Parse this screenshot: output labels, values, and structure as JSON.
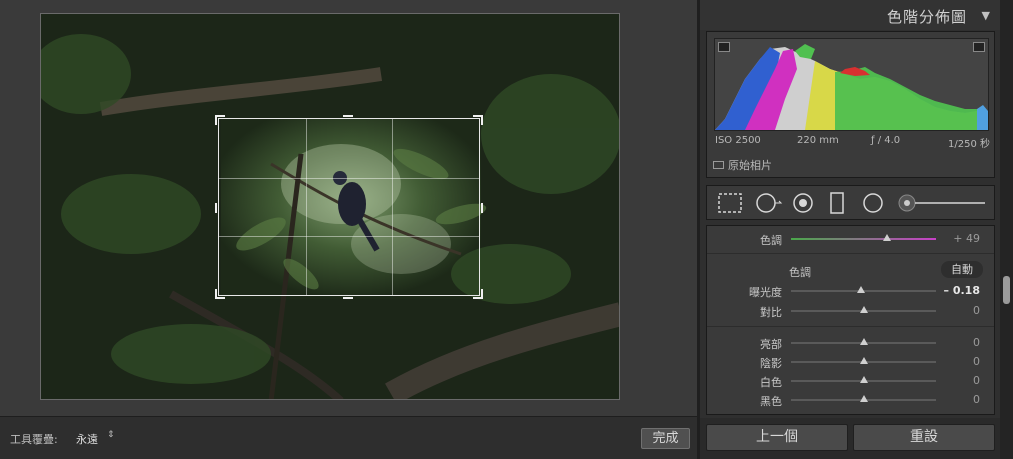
{
  "colors": {
    "accent_green": "#4aa84a",
    "accent_magenta": "#c840c8",
    "panel_bg": "#3a3a3a"
  },
  "canvas": {
    "photo_alt": "",
    "crop_overlay": "crop-frame"
  },
  "toolbar": {
    "overlay_label": "工具覆疊:",
    "overlay_value": "永遠",
    "overlay_arrow": "⇕",
    "done_label": "完成"
  },
  "histogram": {
    "title": "色階分佈圖",
    "collapse_icon": "triangle-down-icon",
    "iso": "ISO 2500",
    "focal": "220 mm",
    "aperture": "ƒ / 4.0",
    "shutter": "1/250 秒",
    "original_label": "原始相片"
  },
  "tools": [
    "crop-icon",
    "spot-removal-icon",
    "redeye-icon",
    "graduated-filter-icon",
    "radial-filter-icon",
    "brush-slider-icon"
  ],
  "adjust": {
    "tint": {
      "label": "色調",
      "value": "+ 49",
      "position": 0.66
    },
    "tone_header": "色調",
    "auto_label": "自動",
    "rows": [
      {
        "label": "曝光度",
        "value": "– 0.18",
        "position": 0.48
      },
      {
        "label": "對比",
        "value": "0",
        "position": 0.5
      },
      {
        "label": "亮部",
        "value": "0",
        "position": 0.5
      },
      {
        "label": "陰影",
        "value": "0",
        "position": 0.5
      },
      {
        "label": "白色",
        "value": "0",
        "position": 0.5
      },
      {
        "label": "黑色",
        "value": "0",
        "position": 0.5
      }
    ]
  },
  "footer": {
    "previous_label": "上一個",
    "reset_label": "重設"
  }
}
